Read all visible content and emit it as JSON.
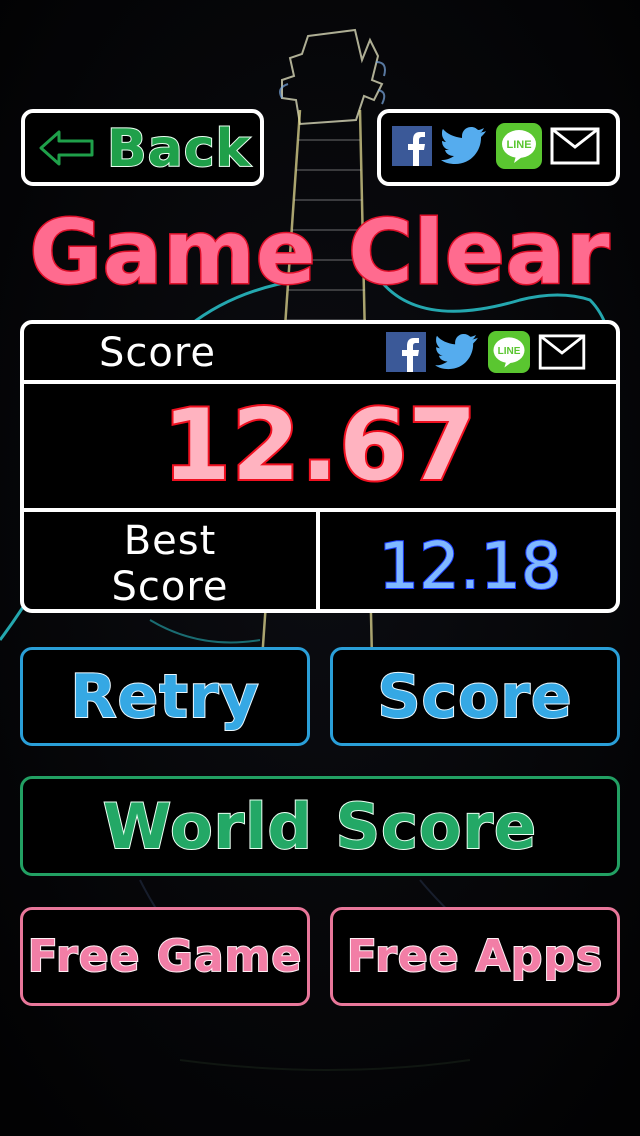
{
  "header": {
    "back_label": "Back",
    "share_icons": [
      "facebook-icon",
      "twitter-icon",
      "line-icon",
      "mail-icon"
    ],
    "line_text": "LINE"
  },
  "title": "Game Clear",
  "score_panel": {
    "label": "Score",
    "value": "12.67",
    "best_label_line1": "Best",
    "best_label_line2": "Score",
    "best_value": "12.18"
  },
  "buttons": {
    "retry": "Retry",
    "score": "Score",
    "world_score": "World Score",
    "free_game": "Free Game",
    "free_apps": "Free Apps"
  },
  "colors": {
    "back_green": "#1fa04a",
    "title_pink": "#ff6b8f",
    "score_red": "#f01020",
    "best_blue": "#7fb8ff",
    "button_blue": "#2a9fd8",
    "button_green": "#22a063",
    "button_pink": "#e8779a",
    "facebook": "#3b5998",
    "twitter": "#55acee",
    "line": "#5ac630"
  }
}
